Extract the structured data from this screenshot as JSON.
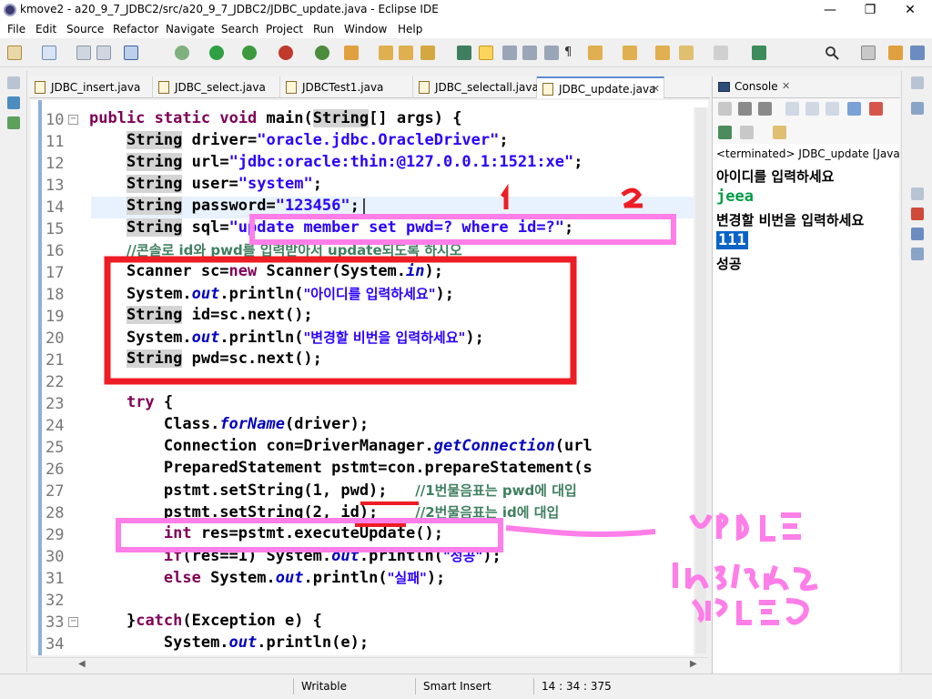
{
  "window": {
    "title": "kmove2 - a20_9_7_JDBC2/src/a20_9_7_JDBC2/JDBC_update.java - Eclipse IDE",
    "minimize": "—",
    "restore": "❐",
    "close": "✕"
  },
  "menu": [
    "File",
    "Edit",
    "Source",
    "Refactor",
    "Navigate",
    "Search",
    "Project",
    "Run",
    "Window",
    "Help"
  ],
  "editor_tabs": [
    {
      "label": "JDBC_insert.java"
    },
    {
      "label": "JDBC_select.java"
    },
    {
      "label": "JDBCTest1.java"
    },
    {
      "label": "JDBC_selectall.java"
    },
    {
      "label": "JDBC_update.java",
      "close": "✕"
    }
  ],
  "line_numbers": [
    "10",
    "11",
    "12",
    "13",
    "14",
    "15",
    "16",
    "17",
    "18",
    "19",
    "20",
    "21",
    "22",
    "23",
    "24",
    "25",
    "26",
    "27",
    "28",
    "29",
    "30",
    "31",
    "32",
    "33",
    "34"
  ],
  "code": {
    "l10": {
      "kw1": "public",
      "kw2": "static",
      "kw3": "void",
      "name": " main(",
      "type": "String",
      "rest": "[] args) {"
    },
    "l11": {
      "type": "String",
      "rest": " driver=",
      "str": "\"oracle.jdbc.OracleDriver\"",
      "end": ";"
    },
    "l12": {
      "type": "String",
      "rest": " url=",
      "str": "\"jdbc:oracle:thin:@127.0.0.1:1521:xe\"",
      "end": ";"
    },
    "l13": {
      "type": "String",
      "rest": " user=",
      "str": "\"system\"",
      "end": ";"
    },
    "l14": {
      "type": "String",
      "rest": " password=",
      "str": "\"123456\"",
      "end": ";"
    },
    "l15": {
      "type": "String",
      "rest": " sql=",
      "str": "\"update member set pwd=? where id=?\"",
      "end": ";"
    },
    "l16": {
      "cmt": "//콘솔로 id와 pwd를 입력받아서 update되도록 하시오"
    },
    "l17": {
      "pre": "Scanner sc=",
      "kw": "new",
      "mid": " Scanner(System.",
      "it": "in",
      "end": ");"
    },
    "l18": {
      "pre": "System.",
      "it": "out",
      "mid": ".println(",
      "str": "\"아이디를 입력하세요\"",
      "end": ");"
    },
    "l19": {
      "type": "String",
      "rest": " id=sc.next();"
    },
    "l20": {
      "pre": "System.",
      "it": "out",
      "mid": ".println(",
      "str": "\"변경할 비번을 입력하세요\"",
      "end": ");"
    },
    "l21": {
      "type": "String",
      "rest": " pwd=sc.next();"
    },
    "l23": {
      "kw": "try",
      "rest": " {"
    },
    "l24": {
      "pre": "Class.",
      "it": "forName",
      "rest": "(driver);"
    },
    "l25": {
      "pre": "Connection con=DriverManager.",
      "it": "getConnection",
      "rest": "(url"
    },
    "l26": {
      "pre": "PreparedStatement pstmt=con.prepareStatement(s"
    },
    "l27": {
      "pre": "pstmt.setString(1, pwd);   ",
      "cmt": "//1번물음표는 pwd에 대입"
    },
    "l28": {
      "pre": "pstmt.setString(2, id);    ",
      "cmt": "//2번물음표는 id에 대입"
    },
    "l29": {
      "kw": "int",
      "rest": " res=pstmt.executeUpdate();"
    },
    "l30": {
      "kw": "if",
      "mid": "(res==1) System.",
      "it": "out",
      "rest": ".println(",
      "str": "\"성공\"",
      "end": ");"
    },
    "l31": {
      "kw": "else",
      "mid": " System.",
      "it": "out",
      "rest": ".println(",
      "str": "\"실패\"",
      "end": ");"
    },
    "l33": {
      "pre": "}",
      "kw": "catch",
      "rest": "(Exception e) {"
    },
    "l34": {
      "pre": "System.",
      "it": "out",
      "rest": ".println(e);"
    }
  },
  "console": {
    "tab_label": "Console",
    "close": "✕",
    "status": "<terminated> JDBC_update [Java App",
    "lines": [
      {
        "text": "아이디를 입력하세요",
        "kind": "out"
      },
      {
        "text": "jeea",
        "kind": "in"
      },
      {
        "text": "변경할 비번을 입력하세요",
        "kind": "out"
      },
      {
        "text": "111",
        "kind": "in-selected"
      },
      {
        "text": "성공",
        "kind": "out"
      }
    ]
  },
  "statusbar": {
    "mode": "Writable",
    "insert": "Smart Insert",
    "position": "14 : 34 : 375"
  },
  "colors": {
    "keyword": "#7f0055",
    "string": "#2a00ff",
    "comment": "#3f7f5f",
    "annotation_red": "#ee1c24",
    "annotation_pink": "#ff7ee8"
  }
}
